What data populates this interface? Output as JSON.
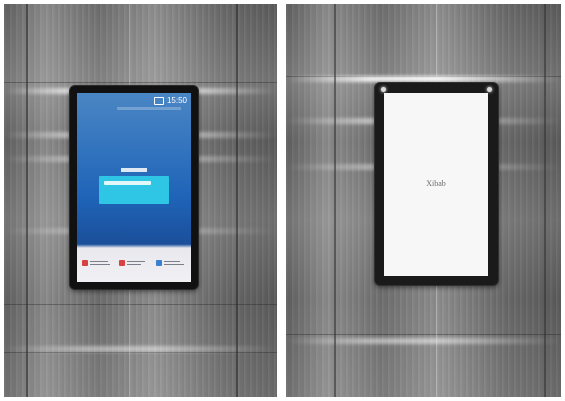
{
  "left_photo": {
    "kiosk": {
      "clock": "15:50",
      "progress_fraction": 0.0,
      "tile_icon_colors": [
        "#d94040",
        "#d94040",
        "#3b7fd0"
      ]
    }
  },
  "right_photo": {
    "kiosk": {
      "boot_text": "Xibab"
    }
  }
}
